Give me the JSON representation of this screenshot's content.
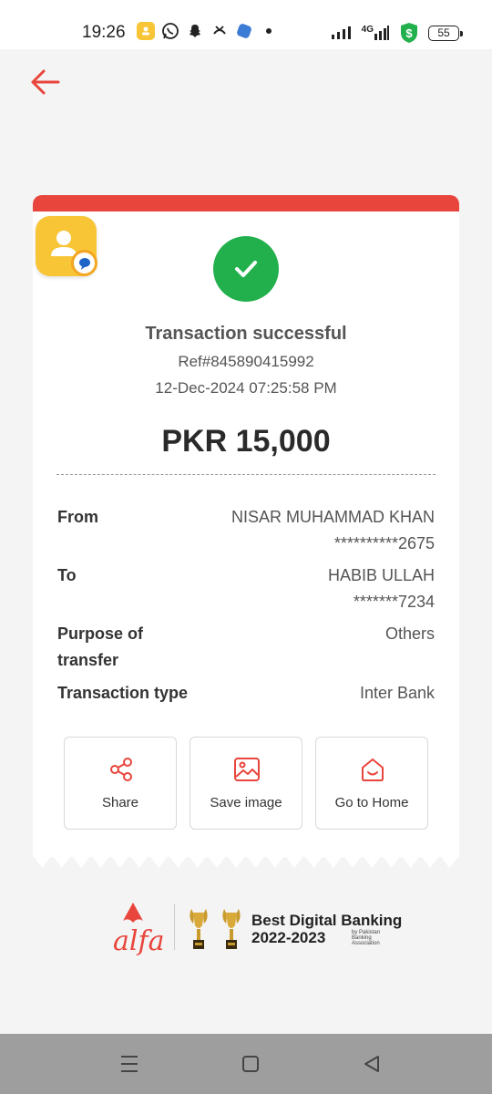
{
  "status_bar": {
    "time": "19:26",
    "network": "4G",
    "battery": "55",
    "notification_icons": [
      "contacts-icon",
      "whatsapp-icon",
      "snapchat-icon",
      "phone-forward-icon",
      "app-icon",
      "dot-icon"
    ]
  },
  "header": {
    "back_icon": "arrow-left-icon"
  },
  "receipt": {
    "status": "Transaction successful",
    "ref": "Ref#845890415992",
    "datetime": "12-Dec-2024 07:25:58 PM",
    "amount": "PKR 15,000",
    "details": {
      "from_label": "From",
      "from_name": "NISAR MUHAMMAD KHAN",
      "from_account": "**********2675",
      "to_label": "To",
      "to_name": "HABIB ULLAH",
      "to_account": "*******7234",
      "purpose_label_line1": "Purpose of",
      "purpose_label_line2": "transfer",
      "purpose_value": "Others",
      "type_label": "Transaction type",
      "type_value": "Inter Bank"
    },
    "actions": [
      {
        "label": "Share",
        "icon": "share-icon"
      },
      {
        "label": "Save image",
        "icon": "image-icon"
      },
      {
        "label": "Go to Home",
        "icon": "home-icon"
      }
    ]
  },
  "footer": {
    "brand": "alfa",
    "award_title": "Best Digital Banking",
    "award_years": "2022-2023",
    "award_by_line1": "by Pakistan",
    "award_by_line2": "Banking Association"
  },
  "colors": {
    "accent": "#e8453c",
    "success": "#22b04c",
    "badge": "#f8c537",
    "nav_bar": "#9e9e9e"
  }
}
